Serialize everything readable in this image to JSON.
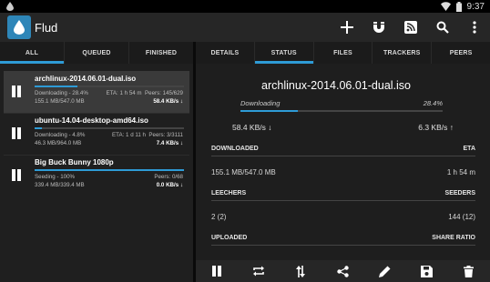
{
  "status_bar": {
    "time": "9:37"
  },
  "app": {
    "title": "Flud"
  },
  "action_bar": {
    "icons": [
      "add-icon",
      "magnet-icon",
      "rss-icon",
      "search-icon",
      "overflow-icon"
    ]
  },
  "left_tabs": [
    {
      "label": "ALL",
      "active": true
    },
    {
      "label": "QUEUED",
      "active": false
    },
    {
      "label": "FINISHED",
      "active": false
    }
  ],
  "right_tabs": [
    {
      "label": "DETAILS",
      "active": false
    },
    {
      "label": "STATUS",
      "active": true
    },
    {
      "label": "FILES",
      "active": false
    },
    {
      "label": "TRACKERS",
      "active": false
    },
    {
      "label": "PEERS",
      "active": false
    }
  ],
  "torrents": [
    {
      "name": "archlinux-2014.06.01-dual.iso",
      "status": "Downloading - 28.4%",
      "progress": 0.284,
      "size": "155.1 MB/547.0 MB",
      "eta": "ETA: 1 h 54 m",
      "peers": "Peers: 145/629",
      "speed": "58.4 KB/s ↓"
    },
    {
      "name": "ubuntu-14.04-desktop-amd64.iso",
      "status": "Downloading - 4.8%",
      "progress": 0.048,
      "size": "46.3 MB/964.0 MB",
      "eta": "ETA: 1 d 11 h",
      "peers": "Peers: 3/3111",
      "speed": "7.4 KB/s ↓"
    },
    {
      "name": "Big Buck Bunny 1080p",
      "status": "Seeding - 100%",
      "progress": 1.0,
      "size": "339.4 MB/339.4 MB",
      "eta": "",
      "peers": "Peers: 0/68",
      "speed": "0.0 KB/s ↓"
    }
  ],
  "details": {
    "name": "archlinux-2014.06.01-dual.iso",
    "status": "Downloading",
    "percent": "28.4%",
    "progress": 0.284,
    "down_speed": "58.4 KB/s ↓",
    "up_speed": "6.3 KB/s ↑",
    "downloaded_label": "DOWNLOADED",
    "eta_label": "ETA",
    "downloaded_value": "155.1 MB/547.0 MB",
    "eta_value": "1 h 54 m",
    "leechers_label": "LEECHERS",
    "seeders_label": "SEEDERS",
    "leechers_value": "2 (2)",
    "seeders_value": "144 (12)",
    "uploaded_label": "UPLOADED",
    "share_ratio_label": "SHARE RATIO"
  },
  "bottom_toolbar": {
    "icons": [
      "pause-icon",
      "repeat-icon",
      "sort-icon",
      "share-icon",
      "edit-icon",
      "save-icon",
      "delete-icon"
    ]
  },
  "colors": {
    "accent": "#2e9bd6",
    "app_icon": "#2e86b8"
  }
}
